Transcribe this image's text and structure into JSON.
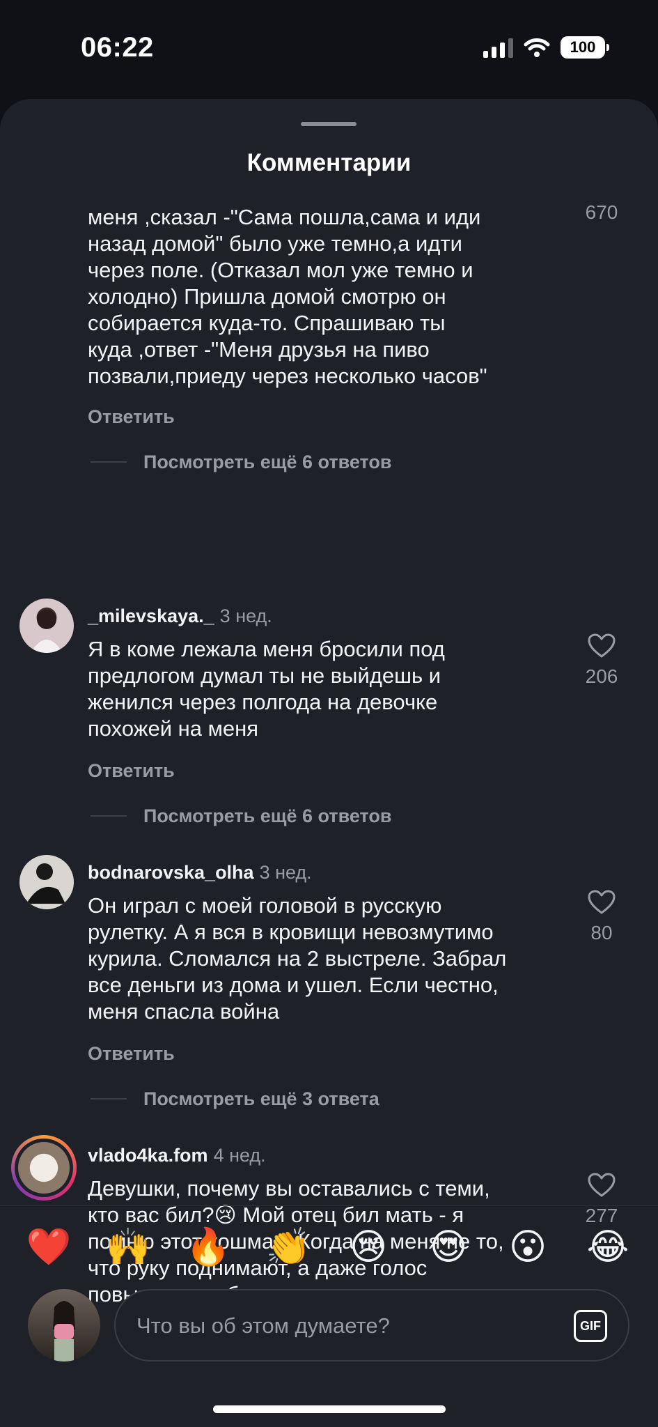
{
  "status_bar": {
    "time": "06:22",
    "battery": "100"
  },
  "sheet": {
    "title": "Комментарии"
  },
  "partial_comment": {
    "lines": [
      "меня ,сказал -\"Сама пошла,сама и иди",
      "назад домой\" было уже темно,а идти",
      "через поле. (Отказал мол уже темно и",
      "холодно) Пришла домой смотрю он",
      "собирается куда-то. Спрашиваю ты",
      "куда ,ответ -\"Меня друзья на пиво",
      "позвали,приеду через несколько часов\""
    ],
    "likes": "670",
    "reply_label": "Ответить",
    "more_replies": "Посмотреть ещё 6 ответов"
  },
  "comments": [
    {
      "username": "_milevskaya._",
      "time": "3 нед.",
      "lines": [
        "Я в коме лежала меня бросили под",
        "предлогом думал ты не выйдешь и",
        "женился через полгода на девочке",
        "похожей на меня"
      ],
      "likes": "206",
      "reply_label": "Ответить",
      "more_replies": "Посмотреть ещё 6 ответов"
    },
    {
      "username": "bodnarovska_olha",
      "time": "3 нед.",
      "lines": [
        "Он играл с моей головой в русскую",
        "рулетку. А я вся в кровищи невозмутимо",
        "курила. Сломался на 2 выстреле. Забрал",
        "все деньги из дома и ушел. Если честно,",
        "меня спасла война"
      ],
      "likes": "80",
      "reply_label": "Ответить",
      "more_replies": "Посмотреть ещё 3 ответа"
    },
    {
      "username": "vlado4ka.fom",
      "time": "4 нед.",
      "lines": [
        "Девушки, почему вы оставались с теми,",
        "кто вас бил?😢 Мой отец бил мать - я",
        "помню этот кошмар. Когда на меня не то,",
        "что руку поднимают, а даже голос",
        "повышают...я бегу со всех ног от этого"
      ],
      "likes": "277"
    }
  ],
  "emoji_bar": [
    "❤️",
    "🙌",
    "🔥",
    "👏",
    "😢",
    "😍",
    "😮",
    "😂"
  ],
  "composer": {
    "placeholder": "Что вы об этом думаете?",
    "gif_label": "GIF"
  },
  "colors": {
    "background": "#0f1116",
    "sheet": "#1f2128",
    "text": "#f3f4f6",
    "muted": "#9a9ca3"
  }
}
